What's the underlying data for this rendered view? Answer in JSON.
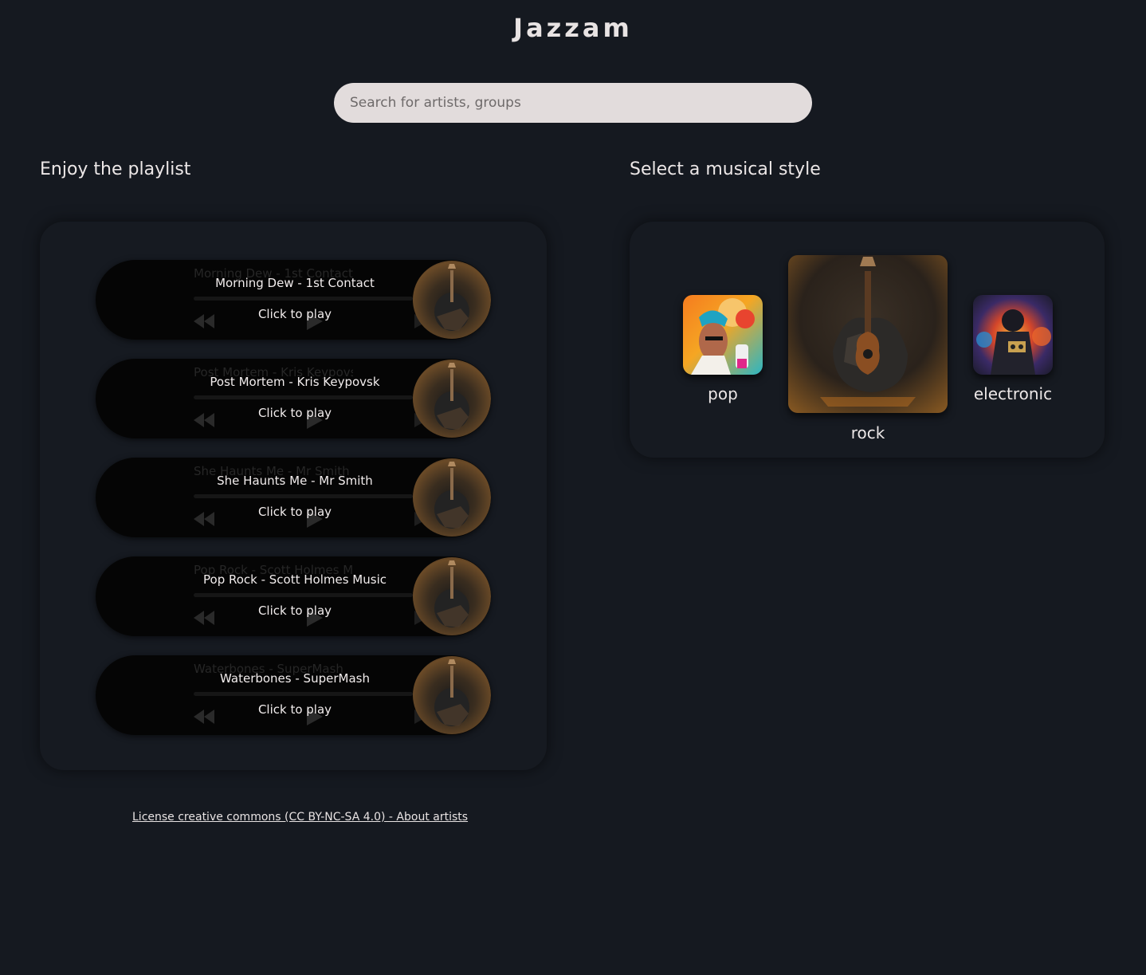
{
  "app": {
    "title": "Jazzam"
  },
  "search": {
    "placeholder": "Search for artists, groups",
    "value": ""
  },
  "playlist": {
    "heading": "Enjoy the playlist",
    "tracks": [
      {
        "title": "Morning Dew - 1st Contact",
        "ghost": "Morning Dew - 1st Contact",
        "action": "Click to play"
      },
      {
        "title": "Post Mortem - Kris Keypovsk",
        "ghost": "Post Mortem - Kris Keypovsk",
        "action": "Click to play"
      },
      {
        "title": "She Haunts Me - Mr Smith",
        "ghost": "She Haunts Me - Mr Smith",
        "action": "Click to play"
      },
      {
        "title": "Pop Rock - Scott Holmes Music",
        "ghost": "Pop Rock - Scott Holmes Mus",
        "action": "Click to play"
      },
      {
        "title": "Waterbones - SuperMash",
        "ghost": "Waterbones - SuperMash",
        "action": "Click to play"
      }
    ]
  },
  "styles": {
    "heading": "Select a musical style",
    "items": [
      {
        "label": "pop"
      },
      {
        "label": "rock"
      },
      {
        "label": "electronic"
      }
    ]
  },
  "footer": {
    "link": "License creative commons (CC BY-NC-SA 4.0) - About artists"
  },
  "colors": {
    "background": "#151920",
    "search_bg": "#e2dcdc",
    "player_bg": "#050505",
    "text": "#e8e3e3"
  }
}
